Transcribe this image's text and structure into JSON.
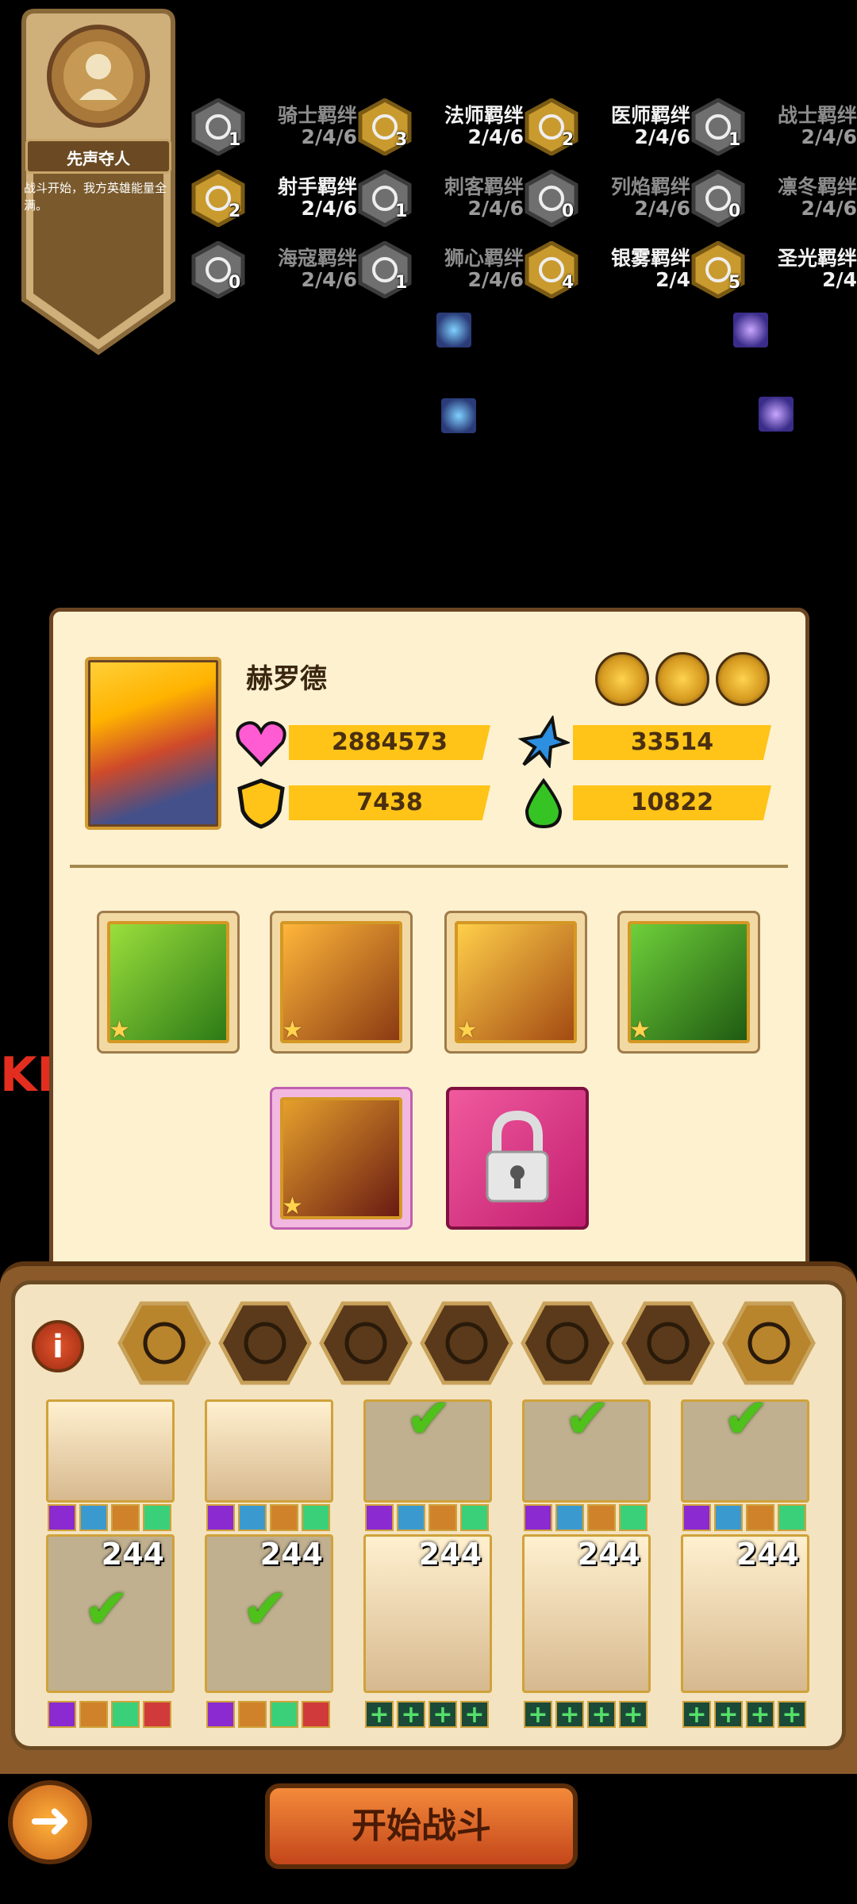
{
  "banner": {
    "title": "先声夺人",
    "description": "战斗开始，我方英雄能量全满。"
  },
  "bonds": [
    {
      "name": "骑士羁绊",
      "tiers": "2/4/6",
      "count": "1",
      "icon": "knight-bond-icon",
      "active": false
    },
    {
      "name": "法师羁绊",
      "tiers": "2/4/6",
      "count": "3",
      "icon": "mage-bond-icon",
      "active": true
    },
    {
      "name": "医师羁绊",
      "tiers": "2/4/6",
      "count": "2",
      "icon": "healer-bond-icon",
      "active": true
    },
    {
      "name": "战士羁绊",
      "tiers": "2/4/6",
      "count": "1",
      "icon": "warrior-bond-icon",
      "active": false
    },
    {
      "name": "射手羁绊",
      "tiers": "2/4/6",
      "count": "2",
      "icon": "archer-bond-icon",
      "active": true
    },
    {
      "name": "刺客羁绊",
      "tiers": "2/4/6",
      "count": "1",
      "icon": "assassin-bond-icon",
      "active": false
    },
    {
      "name": "列焰羁绊",
      "tiers": "2/4/6",
      "count": "0",
      "icon": "flame-bond-icon",
      "active": false
    },
    {
      "name": "凛冬羁绊",
      "tiers": "2/4/6",
      "count": "0",
      "icon": "winter-bond-icon",
      "active": false
    },
    {
      "name": "海寇羁绊",
      "tiers": "2/4/6",
      "count": "0",
      "icon": "pirate-bond-icon",
      "active": false
    },
    {
      "name": "狮心羁绊",
      "tiers": "2/4/6",
      "count": "1",
      "icon": "lionheart-bond-icon",
      "active": false
    },
    {
      "name": "银雾羁绊",
      "tiers": "2/4",
      "count": "4",
      "icon": "silvermist-bond-icon",
      "active": true
    },
    {
      "name": "圣光羁绊",
      "tiers": "2/4",
      "count": "5",
      "icon": "holylight-bond-icon",
      "active": true
    }
  ],
  "hero": {
    "name": "赫罗德",
    "hp": "2884573",
    "attack": "33514",
    "defense": "7438",
    "energy": "10822"
  },
  "side_text": "KD",
  "lineup": {
    "levels": [
      "244",
      "244",
      "244",
      "244",
      "244"
    ]
  },
  "footer": {
    "start_label": "开始战斗"
  },
  "colors": {
    "accent": "#ffc417",
    "panel": "#fdf1cf",
    "lock": "#d92b7f"
  }
}
